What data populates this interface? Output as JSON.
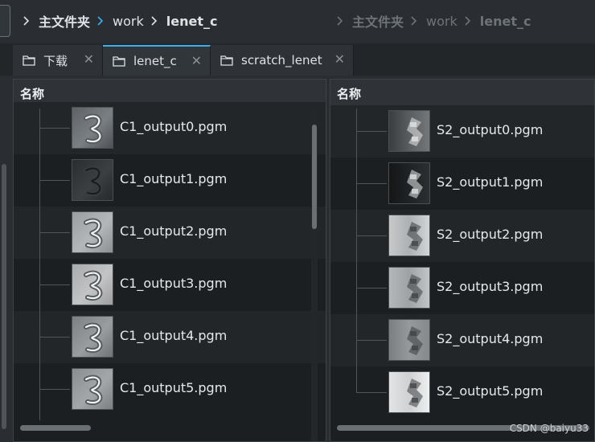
{
  "breadcrumb": {
    "left": [
      "主文件夹",
      "work",
      "lenet_c"
    ],
    "right": [
      "主文件夹",
      "work",
      "lenet_c"
    ]
  },
  "tabs": [
    {
      "label": "下载",
      "icon": "folder-icon",
      "active": false
    },
    {
      "label": "lenet_c",
      "icon": "folder-icon",
      "active": true
    },
    {
      "label": "scratch_lenet",
      "icon": "folder-icon",
      "active": false
    }
  ],
  "tab_close_glyph": "✕",
  "left_pane": {
    "column_header": "名称",
    "files": [
      "C1_output0.pgm",
      "C1_output1.pgm",
      "C1_output2.pgm",
      "C1_output3.pgm",
      "C1_output4.pgm",
      "C1_output5.pgm"
    ]
  },
  "right_pane": {
    "column_header": "名称",
    "files": [
      "S2_output0.pgm",
      "S2_output1.pgm",
      "S2_output2.pgm",
      "S2_output3.pgm",
      "S2_output4.pgm",
      "S2_output5.pgm"
    ]
  },
  "watermark": "CSDN @baiyu33",
  "colors": {
    "accent": "#3daee9",
    "background": "#2a2e32",
    "pane_background": "#1c1f22",
    "row_alt": "#232629"
  }
}
